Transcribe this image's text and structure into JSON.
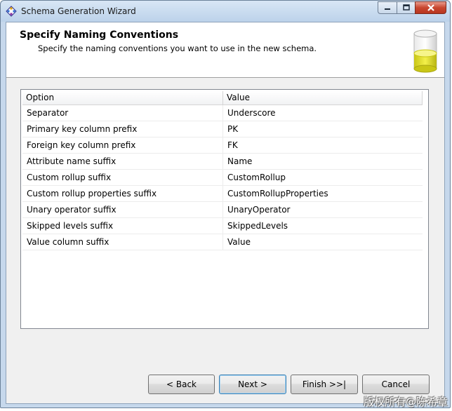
{
  "window": {
    "title": "Schema Generation Wizard"
  },
  "header": {
    "title": "Specify Naming Conventions",
    "subtitle": "Specify the naming conventions you want to use in the new schema."
  },
  "grid": {
    "columns": [
      "Option",
      "Value"
    ],
    "rows": [
      {
        "option": "Separator",
        "value": "Underscore"
      },
      {
        "option": "Primary key column prefix",
        "value": "PK"
      },
      {
        "option": "Foreign key column prefix",
        "value": "FK"
      },
      {
        "option": "Attribute name suffix",
        "value": "Name"
      },
      {
        "option": "Custom rollup suffix",
        "value": "CustomRollup"
      },
      {
        "option": "Custom rollup properties suffix",
        "value": "CustomRollupProperties"
      },
      {
        "option": "Unary operator suffix",
        "value": "UnaryOperator"
      },
      {
        "option": "Skipped levels suffix",
        "value": "SkippedLevels"
      },
      {
        "option": "Value column suffix",
        "value": "Value"
      }
    ]
  },
  "buttons": {
    "back": "< Back",
    "next": "Next >",
    "finish": "Finish >>|",
    "cancel": "Cancel"
  },
  "watermark": "版权所有@陈希章",
  "icons": {
    "app": "wizard-app-icon",
    "minimize": "minimize-icon",
    "maximize": "maximize-icon",
    "close": "close-icon",
    "header": "database-cylinder-icon"
  },
  "colors": {
    "close_button": "#c8462f",
    "header_bg": "#ffffff",
    "dialog_bg": "#f0f0f0",
    "cylinder_liquid": "#e3e12a"
  }
}
